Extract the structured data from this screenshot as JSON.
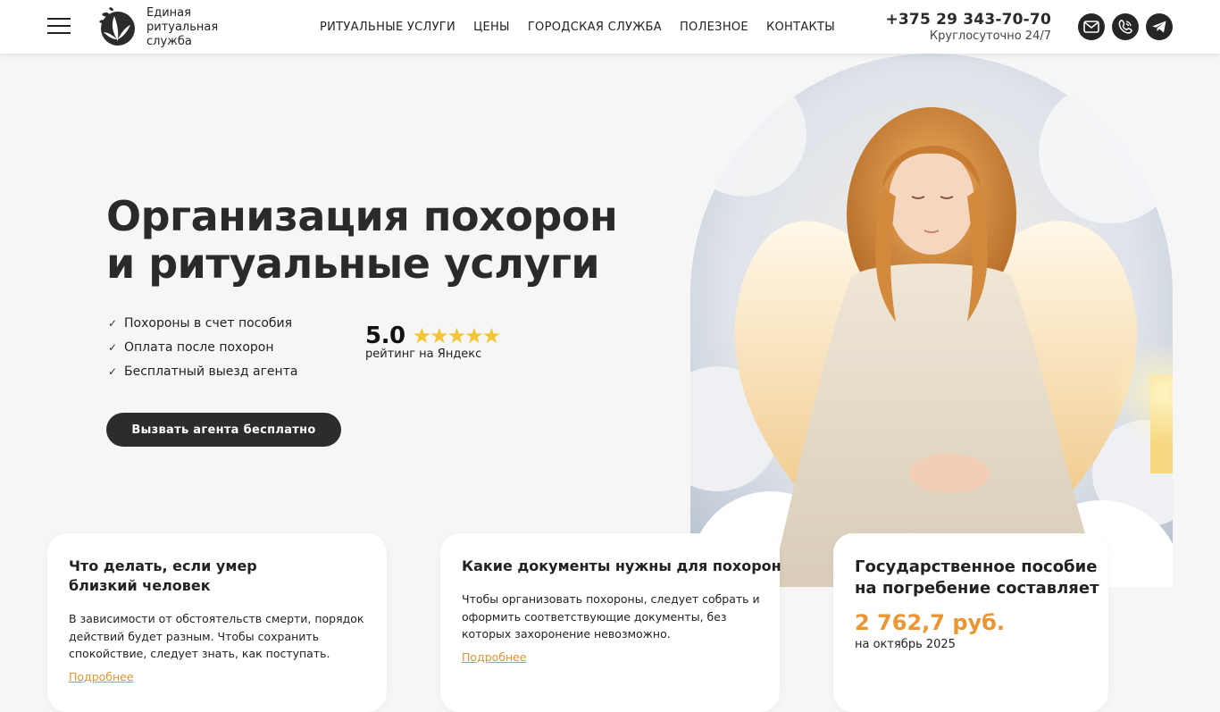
{
  "header": {
    "brand_lines": [
      "Единая",
      "ритуальная",
      "служба"
    ],
    "nav": [
      "РИТУАЛЬНЫЕ УСЛУГИ",
      "ЦЕНЫ",
      "ГОРОДСКАЯ СЛУЖБА",
      "ПОЛЕЗНОЕ",
      "КОНТАКТЫ"
    ],
    "phone": "+375 29 343-70-70",
    "hours": "Круглосуточно 24/7",
    "contact_icons": [
      "mail-icon",
      "viber-icon",
      "telegram-icon"
    ]
  },
  "hero": {
    "title_lines": [
      "Организация похорон",
      "и ритуальные услуги"
    ],
    "bullets": [
      "Похороны в счет пособия",
      "Оплата после похорон",
      "Бесплатный выезд агента"
    ],
    "rating_value": "5.0",
    "rating_stars": 5,
    "rating_caption": "рейтинг на Яндекс",
    "cta_label": "Вызвать агента бесплатно"
  },
  "cards": [
    {
      "title_lines": [
        "Что делать, если умер",
        "близкий человек"
      ],
      "text": "В зависимости от обстоятельств смерти, порядок действий будет разным. Чтобы сохранить спокойствие, следует знать, как поступать.",
      "link": "Подробнее"
    },
    {
      "title_lines": [
        "Какие документы нужны для похорон"
      ],
      "text": "Чтобы организовать похороны, следует собрать и оформить соответствующие документы, без которых захоронение невозможно.",
      "link": "Подробнее"
    },
    {
      "title_lines": [
        "Государственное пособие",
        "на погребение составляет"
      ],
      "amount": "2 762,7 руб.",
      "date": "на октябрь 2025"
    }
  ],
  "colors": {
    "accent": "#ec9533",
    "dark": "#2c2c2c",
    "background": "#f6f6f6",
    "star": "#f5c531"
  }
}
